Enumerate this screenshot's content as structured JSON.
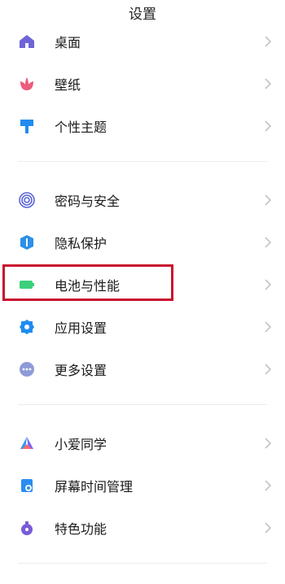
{
  "header": {
    "title": "设置"
  },
  "groups": [
    {
      "items": [
        {
          "label": "桌面",
          "icon": "home-icon"
        },
        {
          "label": "壁纸",
          "icon": "flower-icon"
        },
        {
          "label": "个性主题",
          "icon": "paint-roller-icon"
        }
      ]
    },
    {
      "items": [
        {
          "label": "密码与安全",
          "icon": "fingerprint-icon"
        },
        {
          "label": "隐私保护",
          "icon": "shield-icon"
        },
        {
          "label": "电池与性能",
          "icon": "battery-icon"
        },
        {
          "label": "应用设置",
          "icon": "gear-icon"
        },
        {
          "label": "更多设置",
          "icon": "more-dots-icon"
        }
      ]
    },
    {
      "items": [
        {
          "label": "小爱同学",
          "icon": "xiaoai-icon"
        },
        {
          "label": "屏幕时间管理",
          "icon": "hourglass-icon"
        },
        {
          "label": "特色功能",
          "icon": "feature-icon"
        }
      ]
    }
  ],
  "colors": {
    "highlight": "#c8102e",
    "home": "#6f64d8",
    "flower": "#ec5b7c",
    "roller": "#1f8cf0",
    "fingerprint": "#5a65d6",
    "shield": "#2b90e9",
    "battery": "#3bd07b",
    "gear": "#1f8cf0",
    "dots": "#8f9bd8",
    "hourglass": "#2a8df2",
    "feature": "#7a5bd8"
  }
}
